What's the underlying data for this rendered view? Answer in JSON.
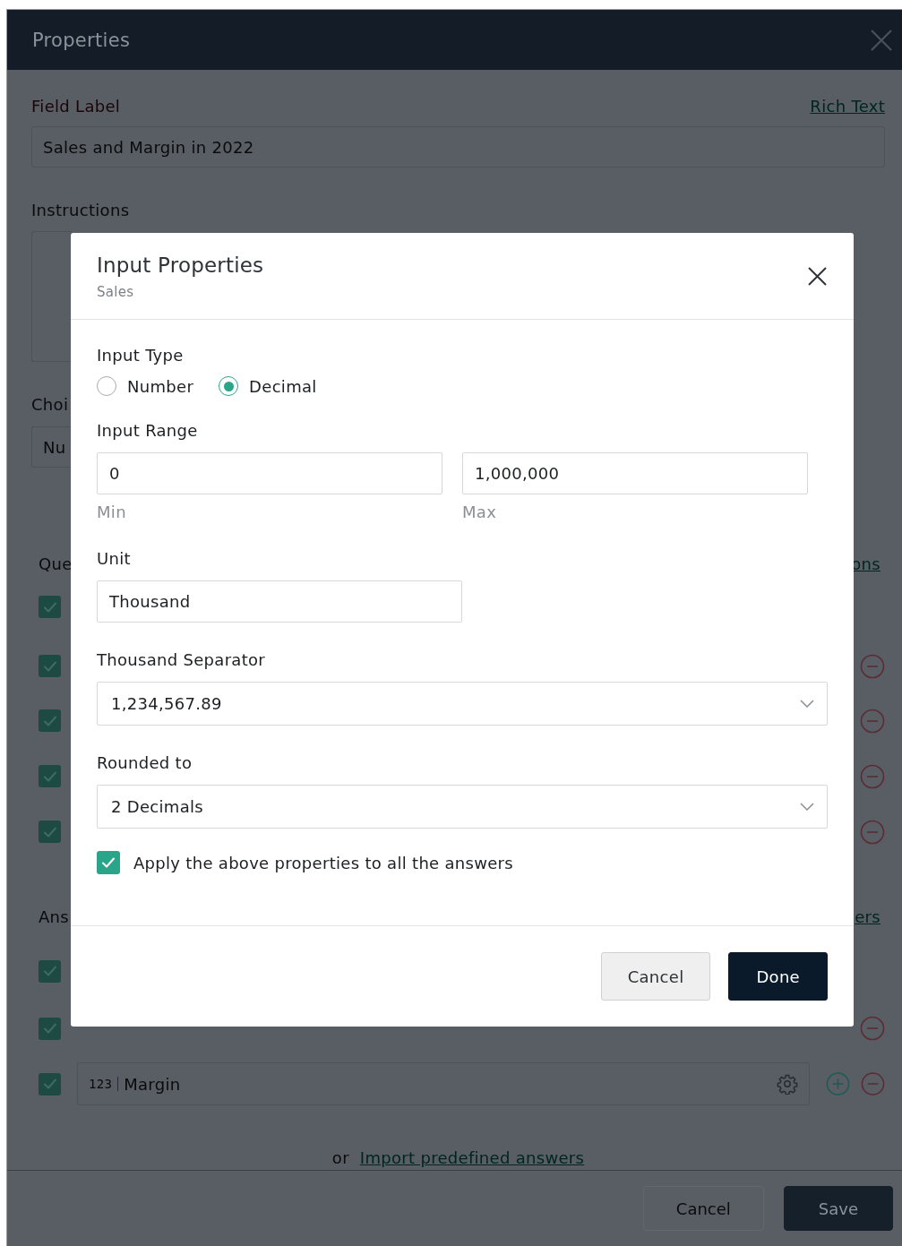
{
  "panel": {
    "title": "Properties",
    "field_label": {
      "label": "Field Label",
      "link": "Rich Text",
      "value": "Sales and Margin in 2022"
    },
    "instructions": {
      "label": "Instructions"
    },
    "choice": {
      "label": "Choi",
      "value": "Nu"
    },
    "questions": {
      "label": "Que",
      "link": "ons",
      "rows": [
        {
          "checked": true,
          "removable": false
        },
        {
          "checked": true,
          "removable": true
        },
        {
          "checked": true,
          "removable": true
        },
        {
          "checked": true,
          "removable": true
        },
        {
          "checked": true,
          "removable": true
        }
      ]
    },
    "answers": {
      "label": "Ans",
      "link": "ers",
      "rows": [
        {
          "checked": true,
          "removable": false
        },
        {
          "checked": true,
          "removable": true
        },
        {
          "checked": true,
          "removable": true,
          "addable": true,
          "type_tag": "123",
          "value": "Margin"
        }
      ]
    },
    "import": {
      "prefix": "or",
      "link": "Import predefined answers"
    },
    "buttons": [
      {
        "label": "Cancel",
        "kind": "secondary"
      },
      {
        "label": "Save",
        "kind": "primary"
      }
    ]
  },
  "dialog": {
    "title": "Input Properties",
    "subtitle": "Sales",
    "input_type": {
      "label": "Input Type",
      "options": [
        {
          "label": "Number",
          "selected": false
        },
        {
          "label": "Decimal",
          "selected": true
        }
      ]
    },
    "input_range": {
      "label": "Input Range",
      "min": {
        "value": "0",
        "caption": "Min"
      },
      "max": {
        "value": "1,000,000",
        "caption": "Max"
      }
    },
    "unit": {
      "label": "Unit",
      "value": "Thousand"
    },
    "thousand_separator": {
      "label": "Thousand Separator",
      "value": "1,234,567.89"
    },
    "rounded_to": {
      "label": "Rounded to",
      "value": "2 Decimals"
    },
    "apply": {
      "label": "Apply the above properties to all the answers",
      "checked": true
    },
    "buttons": [
      {
        "label": "Cancel",
        "kind": "secondary"
      },
      {
        "label": "Done",
        "kind": "primary"
      }
    ]
  }
}
